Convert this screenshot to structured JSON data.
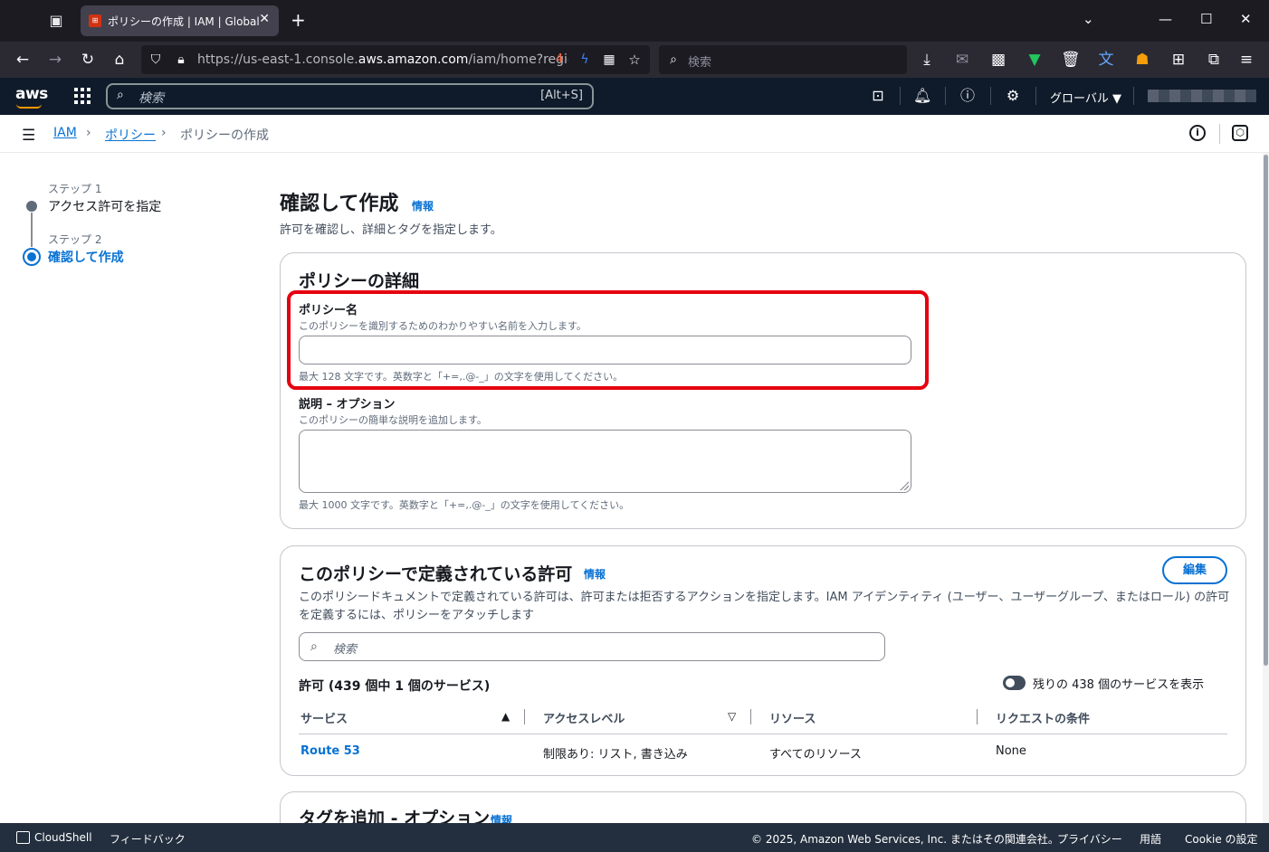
{
  "browser": {
    "tab_title": "ポリシーの作成 | IAM | Global",
    "url_prefix": "https://us-east-1.console.",
    "url_domain": "aws.amazon.com",
    "url_suffix": "/iam/home?region=",
    "search_placeholder": "検索"
  },
  "aws_nav": {
    "logo": "aws",
    "search_placeholder": "検索",
    "search_shortcut": "[Alt+S]",
    "region": "グローバル ▼"
  },
  "breadcrumb": {
    "items": [
      "IAM",
      "ポリシー",
      "ポリシーの作成"
    ]
  },
  "steps": [
    {
      "label": "ステップ 1",
      "name": "アクセス許可を指定"
    },
    {
      "label": "ステップ 2",
      "name": "確認して作成"
    }
  ],
  "page": {
    "title": "確認して作成",
    "info": "情報",
    "description": "許可を確認し、詳細とタグを指定します。"
  },
  "policy_details": {
    "title": "ポリシーの詳細",
    "name_label": "ポリシー名",
    "name_desc": "このポリシーを識別するためのわかりやすい名前を入力します。",
    "name_value": "",
    "name_hint": "最大 128 文字です。英数字と「+=,.@-_」の文字を使用してください。",
    "desc_label": "説明 – オプション",
    "desc_desc": "このポリシーの簡単な説明を追加します。",
    "desc_value": "",
    "desc_hint": "最大 1000 文字です。英数字と「+=,.@-_」の文字を使用してください。"
  },
  "permissions": {
    "title": "このポリシーで定義されている許可",
    "info": "情報",
    "edit_label": "編集",
    "description": "このポリシードキュメントで定義されている許可は、許可または拒否するアクションを指定します。IAM アイデンティティ (ユーザー、ユーザーグループ、またはロール) の許可を定義するには、ポリシーをアタッチします",
    "search_placeholder": "検索",
    "count_label": "許可 (439 個中 1 個のサービス)",
    "toggle_label": "残りの 438 個のサービスを表示",
    "columns": [
      "サービス",
      "アクセスレベル",
      "リソース",
      "リクエストの条件"
    ],
    "rows": [
      {
        "service": "Route 53",
        "access": "制限あり: リスト, 書き込み",
        "resource": "すべてのリソース",
        "condition": "None"
      }
    ]
  },
  "tags": {
    "title": "タグを追加 - オプション",
    "info": "情報"
  },
  "footer": {
    "cloudshell": "CloudShell",
    "feedback": "フィードバック",
    "copyright": "© 2025, Amazon Web Services, Inc. またはその関連会社。",
    "privacy": "プライバシー",
    "terms": "用語",
    "cookie": "Cookie の設定"
  },
  "colors": {
    "link": "#0972d3",
    "highlight": "#e5000f",
    "aws_nav_bg": "#0f1b2a",
    "footer_bg": "#232f3e"
  }
}
